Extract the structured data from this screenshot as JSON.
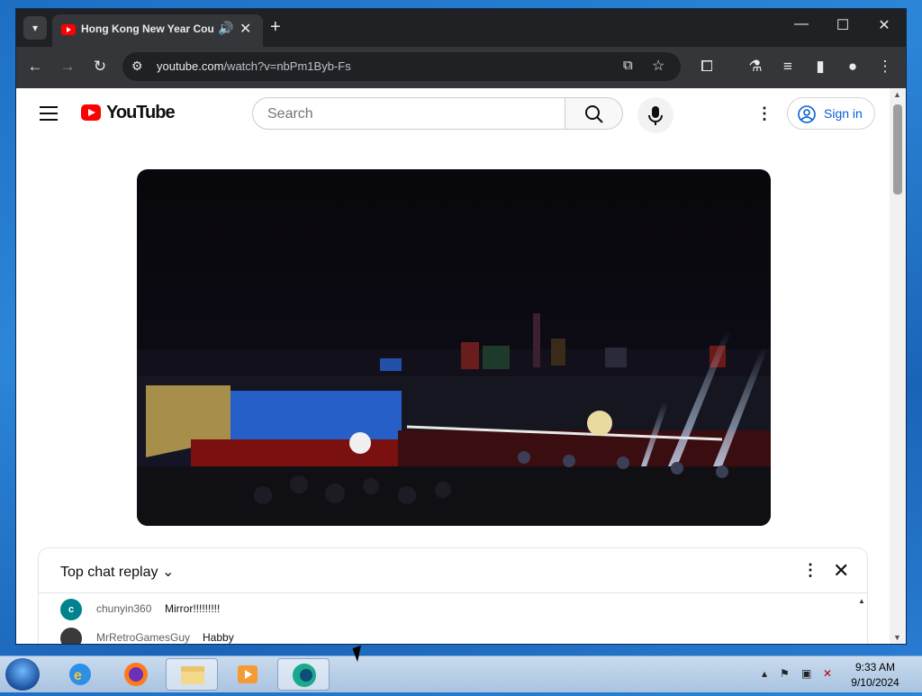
{
  "browser": {
    "tab": {
      "title": "Hong Kong New Year Cou",
      "audio_icon": "speaker-icon",
      "close": "✕"
    },
    "new_tab": "+",
    "window_controls": {
      "minimize": "—",
      "maximize": "☐",
      "close": "✕"
    },
    "url_domain": "youtube.com",
    "url_path": "/watch?v=nbPm1Byb-Fs"
  },
  "youtube": {
    "logo_text": "YouTube",
    "search_placeholder": "Search",
    "sign_in": "Sign in",
    "brand_color": "#ff0000",
    "link_color": "#065fd4"
  },
  "chat": {
    "title": "Top chat replay",
    "messages": [
      {
        "author": "chunyin360",
        "text": "Mirror!!!!!!!!!",
        "avatar_letter": "c",
        "avatar_color": "#00838f"
      },
      {
        "author": "MrRetroGamesGuy",
        "text": "Habby",
        "avatar_letter": "",
        "avatar_color": "#3a3a3a"
      }
    ]
  },
  "taskbar": {
    "time": "9:33 AM",
    "date": "9/10/2024",
    "apps": [
      "start-orb-icon",
      "internet-explorer-icon",
      "firefox-icon",
      "file-explorer-icon",
      "media-player-icon",
      "edge-app-icon"
    ]
  }
}
